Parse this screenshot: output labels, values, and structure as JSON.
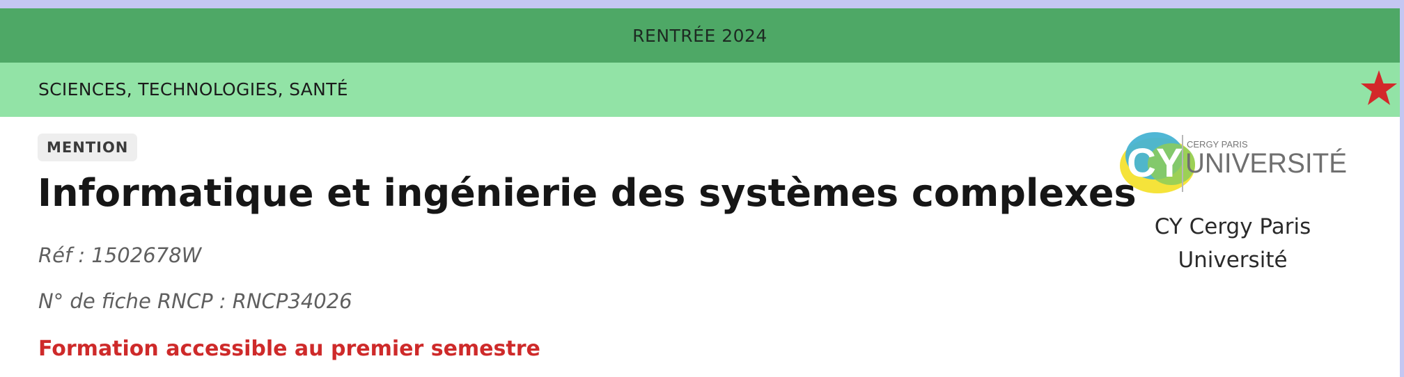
{
  "banner": {
    "year_label": "RENTRÉE 2024",
    "domain_label": "SCIENCES, TECHNOLOGIES, SANTÉ",
    "favorite_icon": "star-icon"
  },
  "formation": {
    "badge": "MENTION",
    "title": "Informatique et ingénierie des systèmes complexes",
    "reference": "Réf : 1502678W",
    "rncp": "N° de fiche RNCP : RNCP34026",
    "access_note": "Formation accessible au premier semestre"
  },
  "university": {
    "logo_small_text": "CERGY PARIS",
    "logo_main_text": "UNIVERSITÉ",
    "logo_initials": "CY",
    "name": "CY Cergy Paris Université"
  },
  "colors": {
    "top_strip": "#c4c7f2",
    "banner_dark_green": "#4ea866",
    "banner_light_green": "#92e3a6",
    "star_red": "#d3282a",
    "access_red": "#ce2a2a"
  }
}
